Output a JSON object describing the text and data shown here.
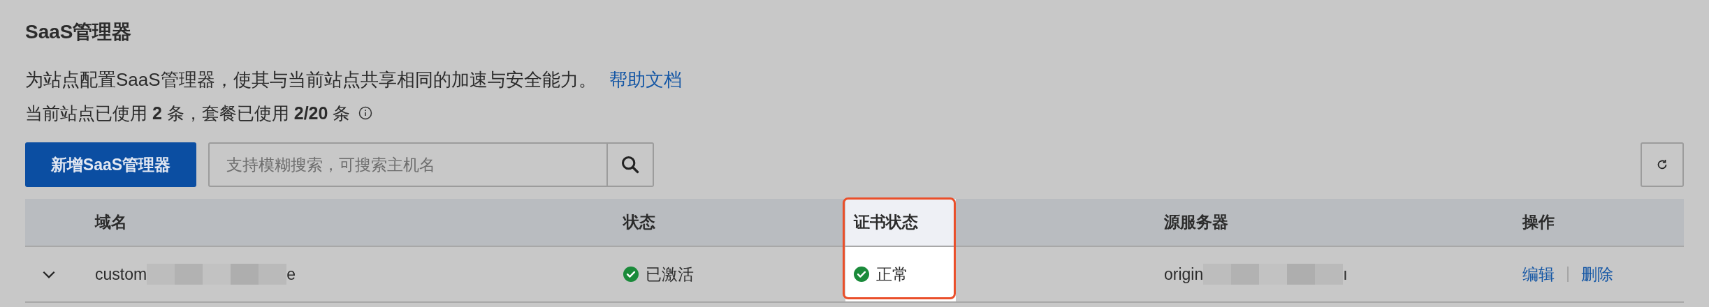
{
  "title": "SaaS管理器",
  "description": {
    "text": "为站点配置SaaS管理器，使其与当前站点共享相同的加速与安全能力。",
    "link": "帮助文档"
  },
  "usage": "当前站点已使用 **2** 条，套餐已使用 **2/20** 条",
  "toolbar": {
    "add_button": "新增SaaS管理器",
    "search": {
      "placeholder": "支持模糊搜索，可搜索主机名"
    }
  },
  "table": {
    "columns": [
      {
        "label": "域名",
        "highlighted": false
      },
      {
        "label": "状态",
        "highlighted": false
      },
      {
        "label": "证书状态",
        "highlighted": true
      },
      {
        "label": "源服务器",
        "highlighted": false
      },
      {
        "label": "操作",
        "highlighted": false
      }
    ],
    "rows": [
      {
        "expanded": false,
        "domain": {
          "visible_start": "custom",
          "visible_end": "e"
        },
        "status": "已激活",
        "cert_status": "正常",
        "origin": {
          "visible_start": "origin",
          "visible_end": "ı"
        },
        "actions": [
          "编辑",
          "删除"
        ]
      }
    ]
  }
}
